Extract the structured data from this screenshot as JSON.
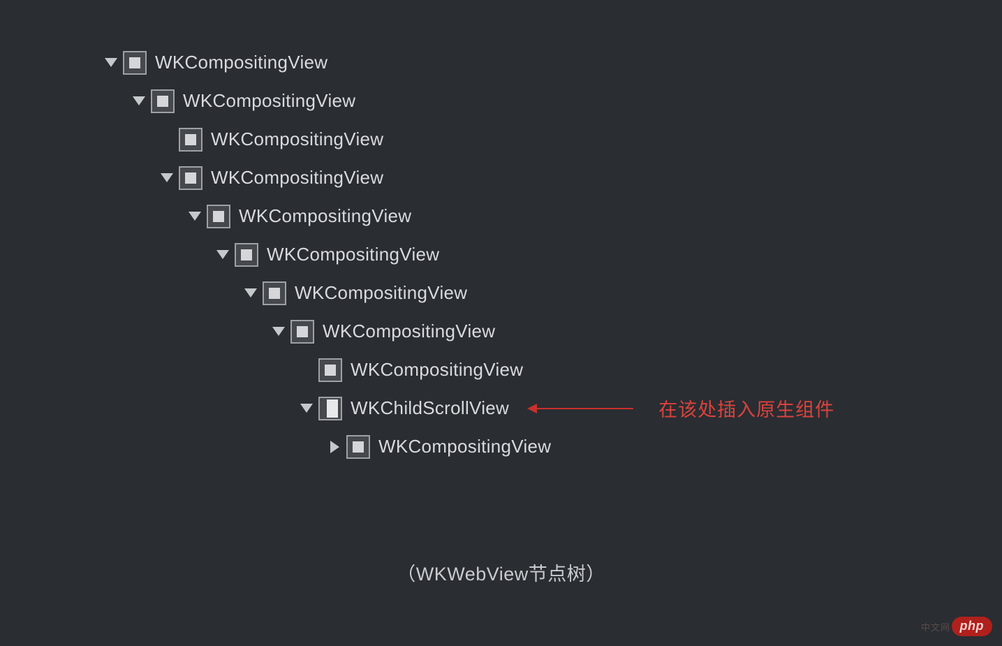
{
  "tree": {
    "nodes": [
      {
        "depth": 0,
        "disclosure": "down",
        "icon": "square",
        "label": "WKCompositingView",
        "annotated": false
      },
      {
        "depth": 1,
        "disclosure": "down",
        "icon": "square",
        "label": "WKCompositingView",
        "annotated": false
      },
      {
        "depth": 2,
        "disclosure": "none",
        "icon": "square",
        "label": "WKCompositingView",
        "annotated": false
      },
      {
        "depth": 2,
        "disclosure": "down",
        "icon": "square",
        "label": "WKCompositingView",
        "annotated": false
      },
      {
        "depth": 3,
        "disclosure": "down",
        "icon": "square",
        "label": "WKCompositingView",
        "annotated": false
      },
      {
        "depth": 4,
        "disclosure": "down",
        "icon": "square",
        "label": "WKCompositingView",
        "annotated": false
      },
      {
        "depth": 5,
        "disclosure": "down",
        "icon": "square",
        "label": "WKCompositingView",
        "annotated": false
      },
      {
        "depth": 6,
        "disclosure": "down",
        "icon": "square",
        "label": "WKCompositingView",
        "annotated": false
      },
      {
        "depth": 7,
        "disclosure": "none",
        "icon": "square",
        "label": "WKCompositingView",
        "annotated": false
      },
      {
        "depth": 7,
        "disclosure": "down",
        "icon": "partial",
        "label": "WKChildScrollView",
        "annotated": true
      },
      {
        "depth": 8,
        "disclosure": "right",
        "icon": "square",
        "label": "WKCompositingView",
        "annotated": false
      }
    ]
  },
  "annotation": {
    "text": "在该处插入原生组件",
    "color": "#d9433d"
  },
  "caption": "（WKWebView节点树）",
  "watermark": {
    "main": "php",
    "sub": "中文网"
  }
}
